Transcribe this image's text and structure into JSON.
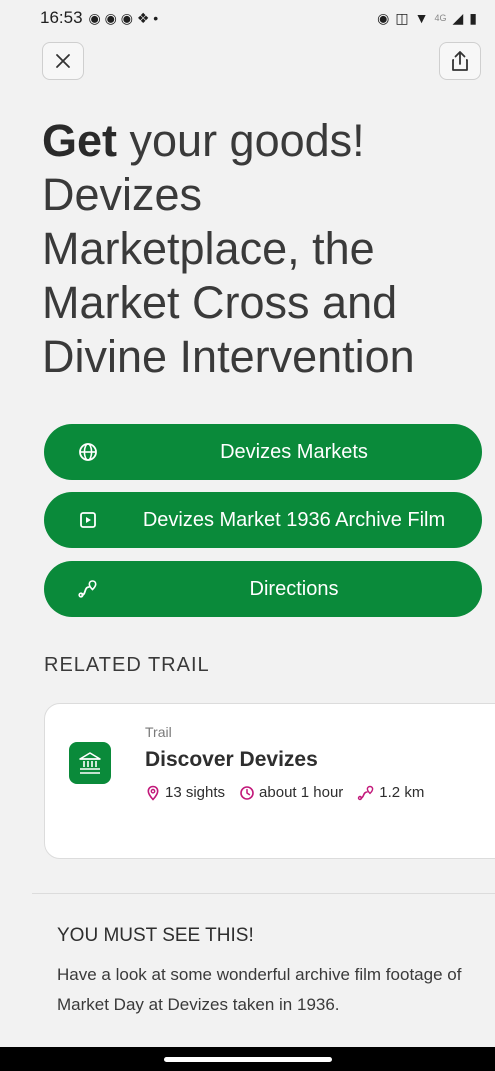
{
  "status_bar": {
    "time": "16:53",
    "network_label": "4G"
  },
  "header": {
    "close_icon": "close-icon",
    "share_icon": "share-icon"
  },
  "title": {
    "strong": "Get",
    "rest": " your goods! Devizes Marketplace, the Market Cross and Divine Intervention"
  },
  "links": [
    {
      "icon": "globe-icon",
      "label": "Devizes Markets"
    },
    {
      "icon": "play-icon",
      "label": "Devizes Market 1936 Archive Film"
    },
    {
      "icon": "route-icon",
      "label": "Directions"
    }
  ],
  "related": {
    "heading": "RELATED TRAIL",
    "trail": {
      "type": "Trail",
      "name": "Discover Devizes",
      "sights": "13 sights",
      "duration": "about 1 hour",
      "distance": "1.2 km"
    }
  },
  "must_see": {
    "heading": "YOU MUST SEE THIS!",
    "body": "Have a look at some wonderful archive film footage of  Market Day at Devizes taken in 1936."
  },
  "colors": {
    "brand_green": "#0a8a3a",
    "accent_magenta": "#c2187a",
    "background": "#f2f2f2"
  }
}
